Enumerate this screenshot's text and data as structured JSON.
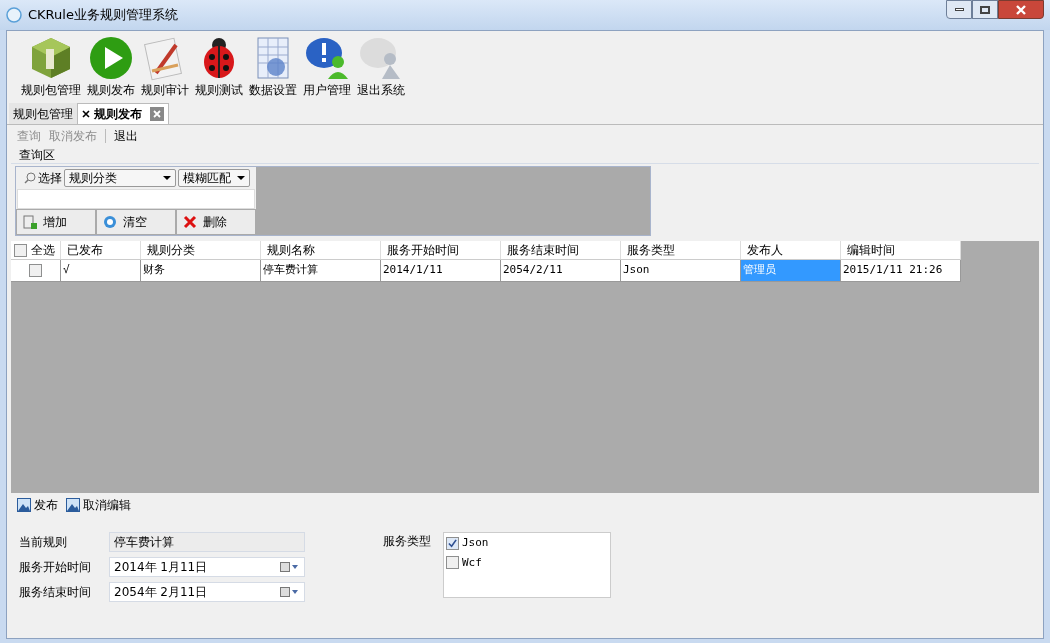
{
  "window": {
    "title": "CKRule业务规则管理系统"
  },
  "toolbar": [
    {
      "label": "规则包管理"
    },
    {
      "label": "规则发布"
    },
    {
      "label": "规则审计"
    },
    {
      "label": "规则测试"
    },
    {
      "label": "数据设置"
    },
    {
      "label": "用户管理"
    },
    {
      "label": "退出系统"
    }
  ],
  "tabs": [
    {
      "label": "规则包管理",
      "selected": false
    },
    {
      "label": "规则发布",
      "selected": true
    }
  ],
  "actions": [
    {
      "label": "查询",
      "disabled": true
    },
    {
      "label": "取消发布",
      "disabled": true
    },
    {
      "label": "退出",
      "disabled": false
    }
  ],
  "query": {
    "title": "查询区",
    "select_label": "选择",
    "field_dropdown": "规则分类",
    "match_dropdown": "模糊匹配",
    "buttons": [
      "增加",
      "清空",
      "删除"
    ]
  },
  "table": {
    "select_all": {
      "label": "全选",
      "checked": false
    },
    "columns": [
      "已发布",
      "规则分类",
      "规则名称",
      "服务开始时间",
      "服务结束时间",
      "服务类型",
      "发布人",
      "编辑时间"
    ],
    "rows": [
      {
        "checked": false,
        "cells": [
          {
            "text": "√",
            "selected": false
          },
          {
            "text": "财务",
            "selected": false
          },
          {
            "text": "停车费计算",
            "selected": false
          },
          {
            "text": "2014/1/11",
            "selected": false
          },
          {
            "text": "2054/2/11",
            "selected": false
          },
          {
            "text": "Json",
            "selected": false
          },
          {
            "text": "管理员",
            "selected": true
          },
          {
            "text": "2015/1/11 21:26",
            "selected": false
          }
        ]
      }
    ]
  },
  "bottom_actions": [
    "发布",
    "取消编辑"
  ],
  "form": {
    "current_rule": {
      "label": "当前规则",
      "value": "停车费计算"
    },
    "start_time": {
      "label": "服务开始时间",
      "value": "2014年 1月11日"
    },
    "end_time": {
      "label": "服务结束时间",
      "value": "2054年 2月11日"
    },
    "service_types": {
      "label": "服务类型",
      "options": [
        {
          "label": "Json",
          "checked": true
        },
        {
          "label": "Wcf",
          "checked": false
        }
      ]
    }
  }
}
